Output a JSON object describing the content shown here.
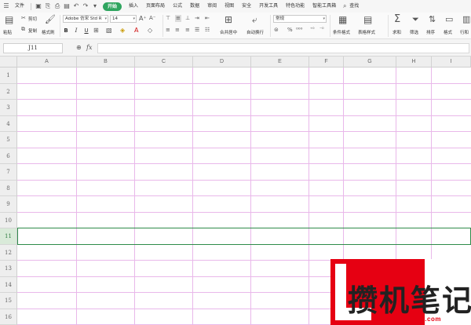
{
  "menubar": {
    "menu_icon": "☰",
    "file_label": "文件",
    "items": [
      "插入",
      "页面布局",
      "公式",
      "数据",
      "审阅",
      "视图",
      "安全",
      "开发工具",
      "特色功能",
      "智能工具箱"
    ],
    "active_tab": "开始",
    "search_label": "查找",
    "search_icon": "search-icon"
  },
  "ribbon": {
    "paste_label": "粘贴",
    "cut_label": "剪切",
    "copy_label": "复制",
    "format_painter_label": "格式刷",
    "font_name": "Adobe 仿宋 Std R",
    "font_size": "14",
    "bold": "B",
    "italic": "I",
    "underline": "U",
    "merge_center_label": "合并居中",
    "wrap_text_label": "自动换行",
    "number_format": "常规",
    "conditional_format_label": "条件格式",
    "table_style_label": "表格样式",
    "sum_label": "求和",
    "filter_label": "筛选",
    "sort_label": "排序",
    "format_label": "格式",
    "rowcol_label": "行和"
  },
  "formula_bar": {
    "cell_ref": "J11",
    "fx_label": "fx",
    "value": ""
  },
  "grid": {
    "columns": [
      "A",
      "B",
      "C",
      "D",
      "E",
      "F",
      "G",
      "H",
      "I"
    ],
    "rows": [
      "1",
      "2",
      "3",
      "4",
      "5",
      "6",
      "7",
      "8",
      "9",
      "10",
      "11",
      "12",
      "13",
      "14",
      "15",
      "16"
    ],
    "selected_row": "11",
    "gridline_color": "#e9b8ea",
    "selection_color": "#2e8b4a"
  },
  "watermark": {
    "text": "攒机笔记",
    "url": "www.cuanjibiji.com",
    "brand_color": "#e60012"
  }
}
